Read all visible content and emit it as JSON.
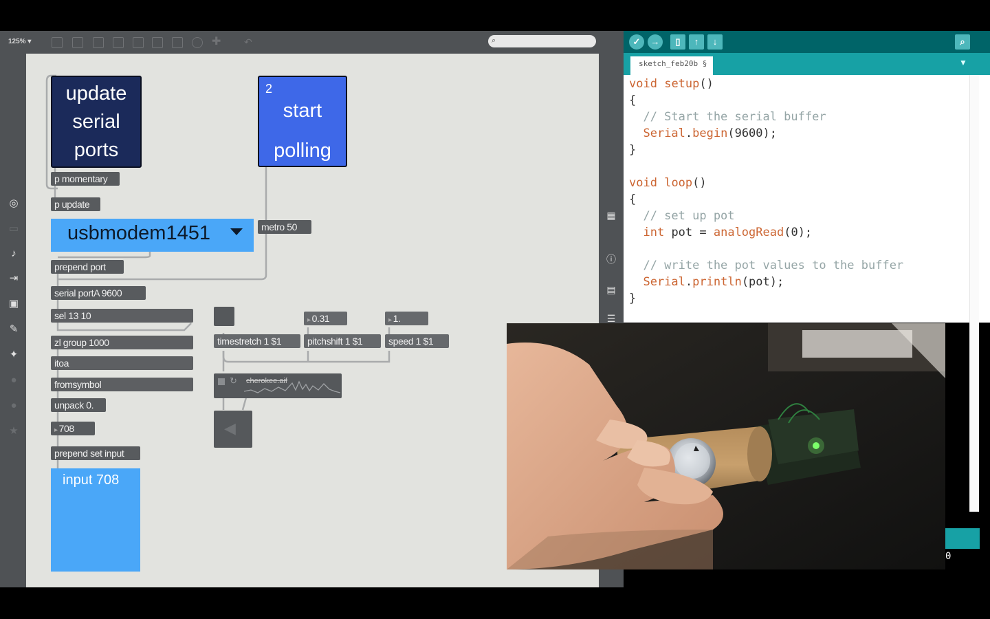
{
  "max": {
    "zoom_label": "125% ▾",
    "objects": {
      "update_button": "update serial ports",
      "start_button_count": "2",
      "start_button": "start polling",
      "p_momentary": "p momentary",
      "p_update": "p update",
      "serial_menu_value": "usbmodem1451",
      "metro": "metro 50",
      "prepend_port": "prepend port",
      "serial_port": "serial portA 9600",
      "sel": "sel 13 10",
      "zl_group": "zl group 1000",
      "itoa": "itoa",
      "fromsymbol": "fromsymbol",
      "unpack": "unpack 0.",
      "number_708": "708",
      "prepend_set": "prepend set input",
      "input_panel": "input 708",
      "num_031": "0.31",
      "num_1": "1.",
      "timestretch": "timestretch 1 $1",
      "pitchshift": "pitchshift 1 $1",
      "speed": "speed 1 $1",
      "buffer_file": "cherokee.aif"
    }
  },
  "arduino": {
    "tab_label": "sketch_feb20b §",
    "code": {
      "l1a": "void",
      "l1b": " ",
      "l1c": "setup",
      "l1d": "()",
      "l2": "{",
      "l3": "  // Start the serial buffer",
      "l4a": "  ",
      "l4b": "Serial",
      "l4c": ".",
      "l4d": "begin",
      "l4e": "(9600);",
      "l5": "}",
      "l7a": "void",
      "l7b": " ",
      "l7c": "loop",
      "l7d": "()",
      "l8": "{",
      "l9": "  // set up pot",
      "l10a": "  ",
      "l10b": "int",
      "l10c": " pot = ",
      "l10d": "analogRead",
      "l10e": "(0);",
      "l12": "  // write the pot values to the buffer",
      "l13a": "  ",
      "l13b": "Serial",
      "l13c": ".",
      "l13d": "println",
      "l13e": "(pot);",
      "l14": "}"
    },
    "console_text": "0"
  },
  "icons": {
    "left_bar": [
      "target-icon",
      "window-icon",
      "music-note-icon",
      "step-icon",
      "image-icon",
      "paperclip-icon",
      "puzzle-icon",
      "globe-icon",
      "globe-alt-icon",
      "star-icon"
    ],
    "right_bar": [
      "grid-icon",
      "info-icon",
      "book-icon",
      "list-icon"
    ]
  },
  "colors": {
    "max_canvas": "#e2e3df",
    "max_chrome": "#4f5255",
    "menu_blue": "#4aa7f8",
    "dark_button": "#1b2a5a",
    "start_button": "#3e68e8",
    "arduino_header": "#006468",
    "arduino_tabbar": "#17a1a5",
    "arduino_keyword": "#cc6633",
    "arduino_comment": "#95a5a6"
  }
}
